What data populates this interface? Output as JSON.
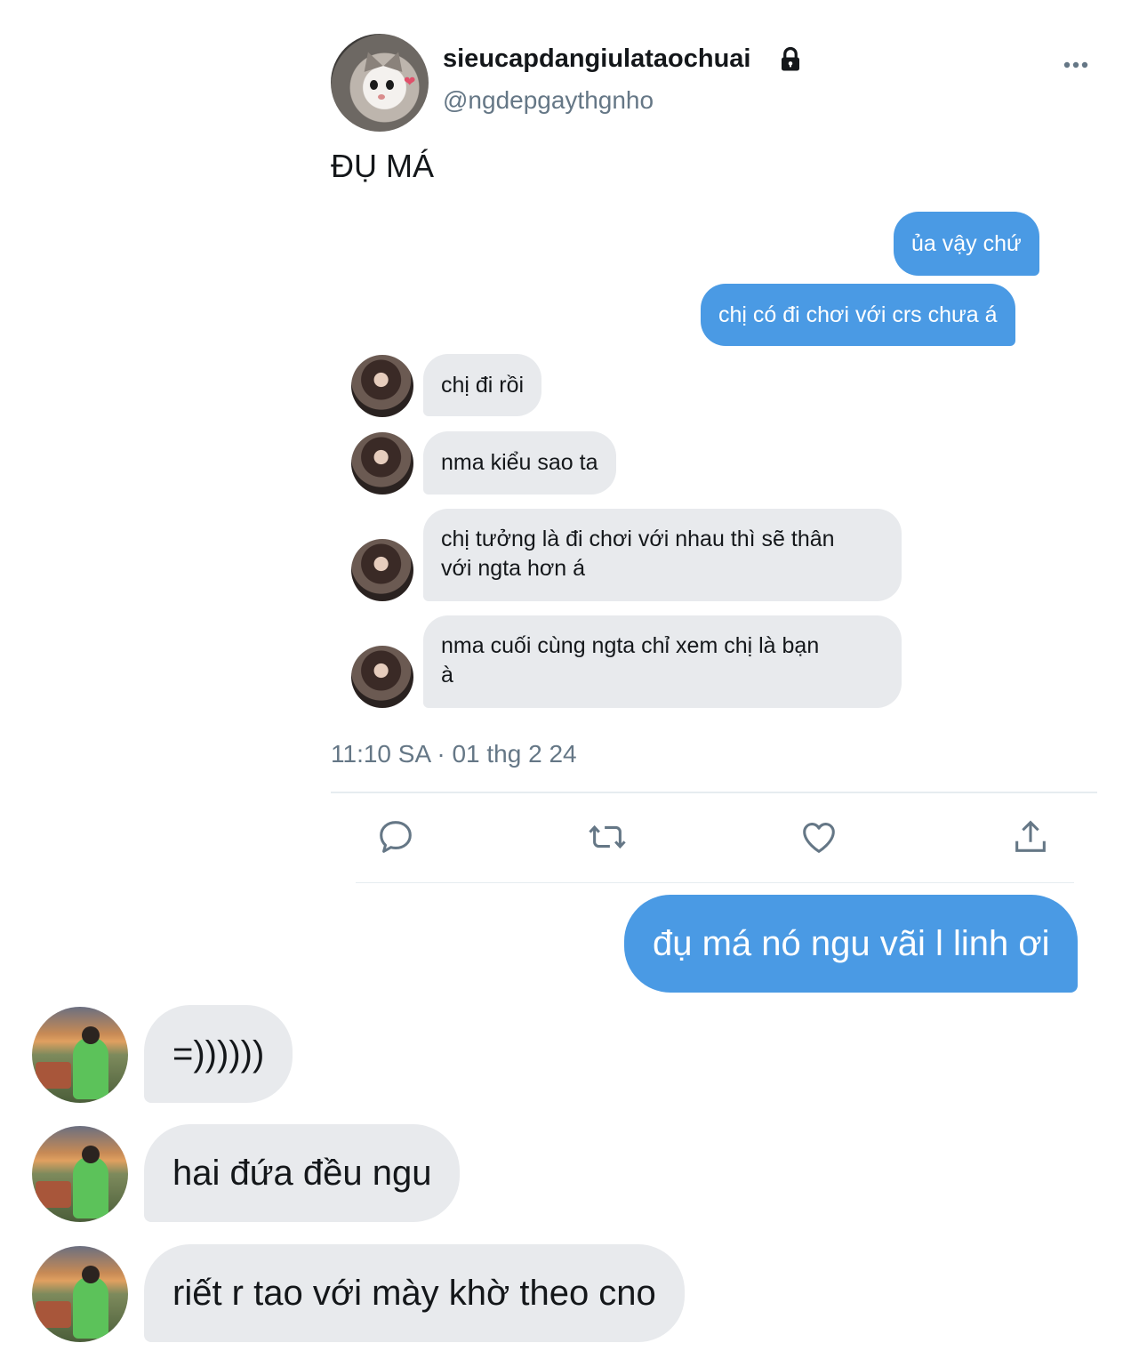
{
  "tweet": {
    "display_name": "sieucapdangiulataochuai",
    "handle": "@ngdepgaythgnho",
    "text": "ĐỤ MÁ",
    "timestamp": "11:10 SA · 01 thg 2 24",
    "icons": {
      "locked": "lock-icon",
      "more": "more-icon",
      "reply": "reply-icon",
      "retweet": "retweet-icon",
      "like": "heart-icon",
      "share": "share-icon"
    },
    "messages": [
      {
        "from": "me",
        "text": "ủa vậy chứ"
      },
      {
        "from": "me",
        "text": "chị có đi chơi với crs chưa á"
      },
      {
        "from": "them",
        "text": "chị đi rồi"
      },
      {
        "from": "them",
        "text": "nma kiểu sao ta"
      },
      {
        "from": "them",
        "line1": "chị tưởng là đi chơi với nhau thì sẽ thân",
        "line2": "với ngta hơn á"
      },
      {
        "from": "them",
        "line1": "nma cuối cùng ngta chỉ xem chị là bạn",
        "line2": "à"
      }
    ]
  },
  "conversation": [
    {
      "from": "me",
      "text": "đụ má nó ngu vãi l linh ơi"
    },
    {
      "from": "them",
      "text": "=))))))"
    },
    {
      "from": "them",
      "text": "hai đứa đều ngu"
    },
    {
      "from": "them",
      "text": "riết r tao với mày khờ theo cno"
    }
  ],
  "colors": {
    "sent_bubble": "#4a9ae4",
    "received_bubble": "#e8eaed",
    "secondary_text": "#657786",
    "primary_text": "#14171a"
  }
}
